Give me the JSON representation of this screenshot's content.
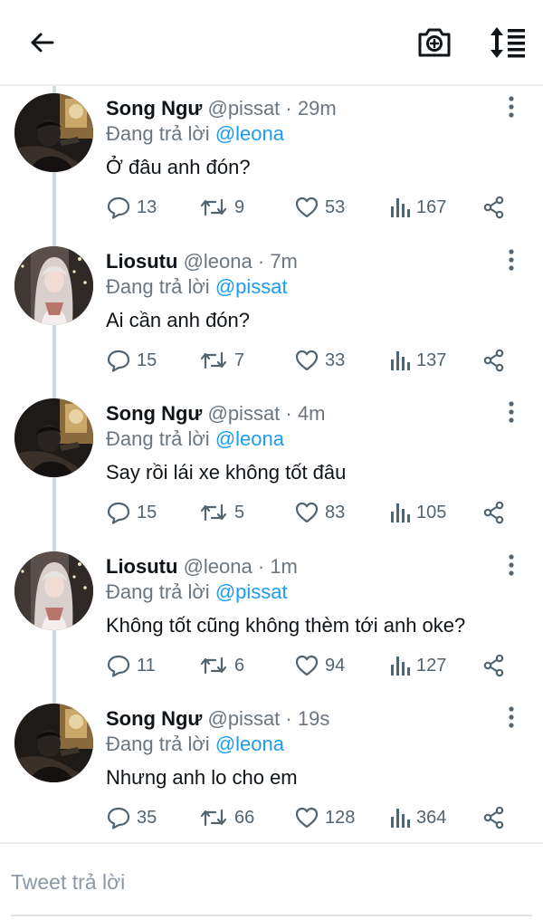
{
  "composer": {
    "placeholder": "Tweet trả lời"
  },
  "tweets": [
    {
      "name": "Song Ngư",
      "handle": "@pissat",
      "separator": "·",
      "time": "29m",
      "reply_prefix": "Đang trả lời",
      "reply_to": "@leona",
      "text": "Ở đâu anh đón?",
      "replies": "13",
      "retweets": "9",
      "likes": "53",
      "views": "167",
      "avatar": "man-avatar"
    },
    {
      "name": "Liosutu",
      "handle": "@leona",
      "separator": "·",
      "time": "7m",
      "reply_prefix": "Đang trả lời",
      "reply_to": "@pissat",
      "text": "Ai cần anh đón?",
      "replies": "15",
      "retweets": "7",
      "likes": "33",
      "views": "137",
      "avatar": "woman-avatar"
    },
    {
      "name": "Song Ngư",
      "handle": "@pissat",
      "separator": "·",
      "time": "4m",
      "reply_prefix": "Đang trả lời",
      "reply_to": "@leona",
      "text": "Say rồi lái xe không tốt đâu",
      "replies": "15",
      "retweets": "5",
      "likes": "83",
      "views": "105",
      "avatar": "man-avatar"
    },
    {
      "name": "Liosutu",
      "handle": "@leona",
      "separator": "·",
      "time": "1m",
      "reply_prefix": "Đang trả lời",
      "reply_to": "@pissat",
      "text": "Không tốt cũng không thèm tới anh oke?",
      "replies": "11",
      "retweets": "6",
      "likes": "94",
      "views": "127",
      "avatar": "woman-avatar"
    },
    {
      "name": "Song Ngư",
      "handle": "@pissat",
      "separator": "·",
      "time": "19s",
      "reply_prefix": "Đang trả lời",
      "reply_to": "@leona",
      "text": "Nhưng anh lo cho em",
      "replies": "35",
      "retweets": "66",
      "likes": "128",
      "views": "364",
      "avatar": "man-avatar"
    }
  ],
  "colors": {
    "mention": "#1d9bf0",
    "secondary_text": "#6b7680",
    "icon": "#536471"
  }
}
